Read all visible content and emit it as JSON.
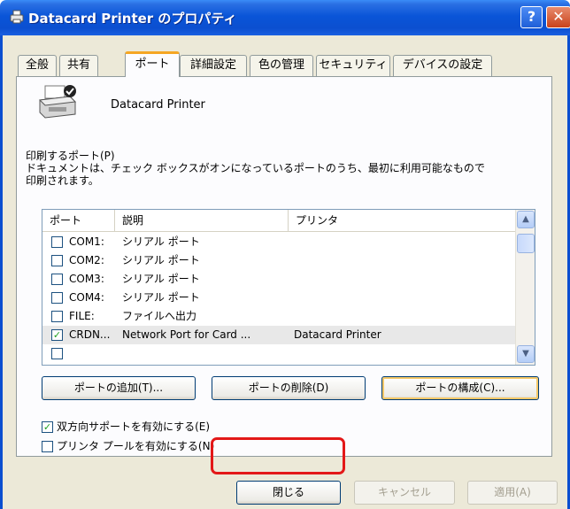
{
  "window": {
    "title": "Datacard Printer のプロパティ",
    "help_glyph": "?",
    "close_glyph": "✕"
  },
  "tabs": [
    {
      "label": "全般",
      "active": false
    },
    {
      "label": "共有",
      "active": false
    },
    {
      "label": "ポート",
      "active": true
    },
    {
      "label": "詳細設定",
      "active": false
    },
    {
      "label": "色の管理",
      "active": false
    },
    {
      "label": "セキュリティ",
      "active": false
    },
    {
      "label": "デバイスの設定",
      "active": false
    }
  ],
  "printer": {
    "name": "Datacard Printer",
    "icon": "printer-icon"
  },
  "description": {
    "line1": "印刷するポート(P)",
    "line2": "ドキュメントは、チェック ボックスがオンになっているポートのうち、最初に利用可能なもので",
    "line3": "印刷されます。"
  },
  "ports_table": {
    "columns": [
      "ポート",
      "説明",
      "プリンタ"
    ],
    "rows": [
      {
        "checked": false,
        "port": "COM1:",
        "desc": "シリアル ポート",
        "printer": ""
      },
      {
        "checked": false,
        "port": "COM2:",
        "desc": "シリアル ポート",
        "printer": ""
      },
      {
        "checked": false,
        "port": "COM3:",
        "desc": "シリアル ポート",
        "printer": ""
      },
      {
        "checked": false,
        "port": "COM4:",
        "desc": "シリアル ポート",
        "printer": ""
      },
      {
        "checked": false,
        "port": "FILE:",
        "desc": "ファイルへ出力",
        "printer": ""
      },
      {
        "checked": true,
        "port": "CRDN...",
        "desc": "Network Port for Card ...",
        "printer": "Datacard Printer",
        "selected": true
      }
    ]
  },
  "port_buttons": {
    "add": "ポートの追加(T)...",
    "delete": "ポートの削除(D)",
    "configure": "ポートの構成(C)..."
  },
  "options": {
    "bidirectional": {
      "label": "双方向サポートを有効にする(E)",
      "checked": true
    },
    "pooling": {
      "label": "プリンタ プールを有効にする(N)",
      "checked": false
    }
  },
  "footer": {
    "close": "閉じる",
    "cancel": "キャンセル",
    "apply": "適用(A)"
  },
  "colors": {
    "titlebar": "#0b4fd0",
    "dialog_bg": "#ece9d8",
    "highlight": "#e31818"
  }
}
